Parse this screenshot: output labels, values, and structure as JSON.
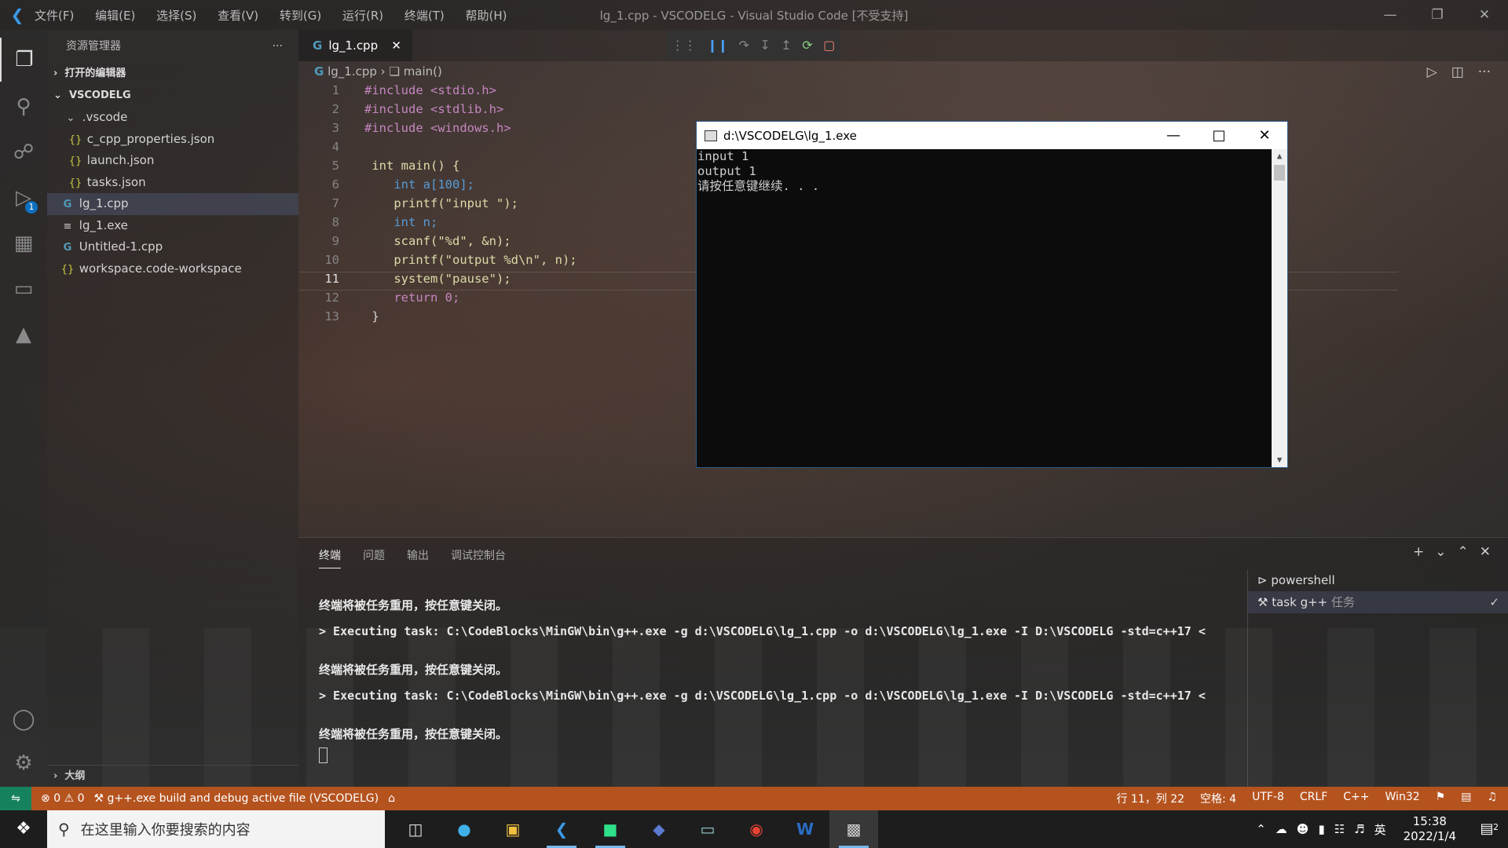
{
  "window": {
    "title": "lg_1.cpp - VSCODELG - Visual Studio Code [不受支持]",
    "menu": [
      "文件(F)",
      "编辑(E)",
      "选择(S)",
      "查看(V)",
      "转到(G)",
      "运行(R)",
      "终端(T)",
      "帮助(H)"
    ]
  },
  "activity": {
    "debug_badge": "1"
  },
  "sidebar": {
    "title": "资源管理器",
    "open_editors": "打开的编辑器",
    "folder": "VSCODELG",
    "items": [
      {
        "label": ".vscode",
        "icon": "chevron-down"
      },
      {
        "label": "c_cpp_properties.json",
        "icon": "json-braces"
      },
      {
        "label": "launch.json",
        "icon": "json-braces"
      },
      {
        "label": "tasks.json",
        "icon": "json-braces"
      },
      {
        "label": "lg_1.cpp",
        "icon": "cpp"
      },
      {
        "label": "lg_1.exe",
        "icon": "lines"
      },
      {
        "label": "Untitled-1.cpp",
        "icon": "cpp"
      },
      {
        "label": "workspace.code-workspace",
        "icon": "json-braces"
      }
    ],
    "outline": "大纲"
  },
  "editor": {
    "tab": "lg_1.cpp",
    "breadcrumb": {
      "file": "lg_1.cpp",
      "symbol": "main()"
    },
    "current_line": 11,
    "line_numbers": [
      "1",
      "2",
      "3",
      "4",
      "5",
      "6",
      "7",
      "8",
      "9",
      "10",
      "11",
      "12",
      "13"
    ],
    "lines": [
      "#include <stdio.h>",
      "#include <stdlib.h>",
      "#include <windows.h>",
      "",
      " int main() {",
      "    int a[100];",
      "    printf(\"input \");",
      "    int n;",
      "    scanf(\"%d\", &n);",
      "    printf(\"output %d\\n\", n);",
      "    system(\"pause\");",
      "    return 0;",
      " }"
    ]
  },
  "console": {
    "title": "d:\\VSCODELG\\lg_1.exe",
    "lines": [
      "input 1",
      "output 1",
      "请按任意键继续. . ."
    ]
  },
  "panel": {
    "tabs": [
      "终端",
      "问题",
      "输出",
      "调试控制台"
    ],
    "terminal_lines": [
      "终端将被任务重用，按任意键关闭。",
      "",
      "> Executing task: C:\\CodeBlocks\\MinGW\\bin\\g++.exe -g d:\\VSCODELG\\lg_1.cpp -o d:\\VSCODELG\\lg_1.exe -I D:\\VSCODELG -std=c++17 <",
      "",
      "终端将被任务重用，按任意键关闭。",
      "",
      "> Executing task: C:\\CodeBlocks\\MinGW\\bin\\g++.exe -g d:\\VSCODELG\\lg_1.cpp -o d:\\VSCODELG\\lg_1.exe -I D:\\VSCODELG -std=c++17 <",
      "",
      "终端将被任务重用，按任意键关闭。"
    ],
    "terminals": [
      {
        "name": "powershell",
        "suffix": ""
      },
      {
        "name": "task g++",
        "suffix": "任务"
      }
    ]
  },
  "statusbar": {
    "errors": "0",
    "warnings": "0",
    "task": "g++.exe build and debug active file (VSCODELG)",
    "position": "行 11，列 22",
    "spaces": "空格: 4",
    "encoding": "UTF-8",
    "eol": "CRLF",
    "language": "C++",
    "platform": "Win32"
  },
  "taskbar": {
    "search_placeholder": "在这里输入你要搜索的内容",
    "ime": "英",
    "time": "15:38",
    "date": "2022/1/4",
    "notifications": "2"
  },
  "colors": {
    "statusbar": "#b5531f",
    "accent": "#0e70c0"
  }
}
